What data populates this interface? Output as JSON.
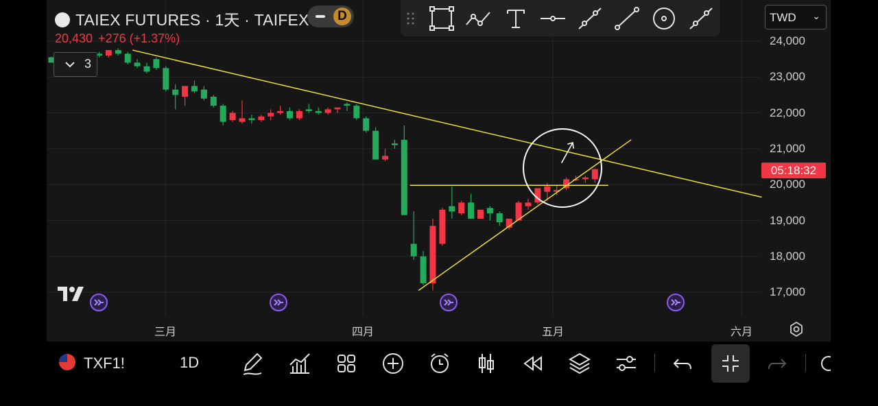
{
  "header": {
    "title": "TAIEX FUTURES · 1天 · TAIFEX",
    "badge": "D",
    "price": "20,430",
    "change": "+276 (+1.37%)",
    "indicator_count": "3"
  },
  "currency": {
    "label": "TWD"
  },
  "timer": "05:18:32",
  "bottom_bar": {
    "symbol": "TXF1!",
    "interval": "1D"
  },
  "colors": {
    "up": "#f23645",
    "down": "#22ab5a",
    "trend": "#f0e132",
    "bg": "#161616"
  },
  "chart_data": {
    "type": "candlestick",
    "title": "TAIEX FUTURES · 1天 · TAIFEX",
    "y_ticks": [
      "24,000",
      "23,000",
      "22,000",
      "21,000",
      "20,000",
      "19,000",
      "18,000",
      "17,000"
    ],
    "y_tick_values": [
      24000,
      23000,
      22000,
      21000,
      20000,
      19000,
      18000,
      17000
    ],
    "x_ticks": [
      "三月",
      "四月",
      "五月",
      "六月"
    ],
    "ylim": [
      16550,
      24250
    ],
    "up_color": "#f23645",
    "down_color": "#22ab5a",
    "candles": [
      [
        23550,
        23570,
        23500,
        23400
      ],
      [
        23500,
        23600,
        23450,
        23650
      ],
      [
        23650,
        23700,
        23550,
        23550
      ],
      [
        23550,
        23650,
        23480,
        23600
      ],
      [
        23600,
        23700,
        23550,
        23650
      ],
      [
        23650,
        23700,
        23550,
        23600
      ],
      [
        23600,
        23750,
        23550,
        23750
      ],
      [
        23750,
        23800,
        23600,
        23650
      ],
      [
        23650,
        23700,
        23350,
        23400
      ],
      [
        23400,
        23500,
        23250,
        23300
      ],
      [
        23300,
        23400,
        23100,
        23150
      ],
      [
        23500,
        23550,
        23200,
        23250
      ],
      [
        23250,
        23300,
        22600,
        22650
      ],
      [
        22650,
        22800,
        22100,
        22500
      ],
      [
        22450,
        22600,
        22200,
        22750
      ],
      [
        22750,
        22900,
        22550,
        22600
      ],
      [
        22650,
        22750,
        22350,
        22400
      ],
      [
        22450,
        22500,
        22150,
        22200
      ],
      [
        22200,
        22250,
        21650,
        21750
      ],
      [
        21800,
        22050,
        21750,
        22000
      ],
      [
        21750,
        22350,
        21700,
        21850
      ],
      [
        21850,
        21950,
        21700,
        21800
      ],
      [
        21800,
        21950,
        21750,
        21900
      ],
      [
        21900,
        22100,
        21800,
        22000
      ],
      [
        22000,
        22200,
        21950,
        22050
      ],
      [
        22050,
        22150,
        21800,
        21850
      ],
      [
        21850,
        22100,
        21800,
        22050
      ],
      [
        22100,
        22250,
        22000,
        22050
      ],
      [
        22050,
        22150,
        21950,
        22000
      ],
      [
        22000,
        22150,
        21950,
        22100
      ],
      [
        22100,
        22150,
        22000,
        22150
      ],
      [
        22250,
        22300,
        22050,
        22200
      ],
      [
        22200,
        22250,
        21800,
        21850
      ],
      [
        21850,
        21900,
        21450,
        21500
      ],
      [
        21500,
        21600,
        20700,
        20700
      ],
      [
        20700,
        21000,
        20650,
        20800
      ],
      [
        21150,
        21250,
        21000,
        21100
      ],
      [
        21250,
        21650,
        19150,
        19150
      ],
      [
        18350,
        19250,
        17900,
        18000
      ],
      [
        18000,
        18150,
        17200,
        17250
      ],
      [
        17250,
        19050,
        17050,
        18850
      ],
      [
        18350,
        19350,
        18300,
        19300
      ],
      [
        19400,
        19950,
        19050,
        19250
      ],
      [
        19200,
        19550,
        19150,
        19500
      ],
      [
        19500,
        19750,
        19350,
        19050
      ],
      [
        19050,
        19300,
        19050,
        19300
      ],
      [
        19350,
        19400,
        19000,
        19200
      ],
      [
        19200,
        19250,
        18850,
        18950
      ],
      [
        18800,
        19050,
        18750,
        19050
      ],
      [
        19000,
        19550,
        19050,
        19500
      ],
      [
        19400,
        19600,
        19300,
        19500
      ],
      [
        19500,
        19900,
        19450,
        19900
      ],
      [
        19800,
        20050,
        19550,
        19950
      ],
      [
        19800,
        20000,
        19700,
        19850
      ],
      [
        19900,
        20200,
        19850,
        20150
      ],
      [
        20150,
        20250,
        20100,
        20150
      ],
      [
        20150,
        20250,
        20050,
        20200
      ],
      [
        20150,
        20450,
        20050,
        20430
      ]
    ],
    "trendlines": [
      {
        "name": "descending",
        "from": [
          "2025-02-21",
          23750
        ],
        "to": [
          "2025-06-06",
          19650
        ]
      },
      {
        "name": "support",
        "from": [
          "2025-04-09",
          17050
        ],
        "to": [
          "2025-05-14",
          21250
        ]
      },
      {
        "name": "horizontal",
        "from": [
          "2025-04-09",
          19980
        ],
        "to": [
          "2025-05-07",
          19980
        ]
      }
    ],
    "grid": true
  }
}
